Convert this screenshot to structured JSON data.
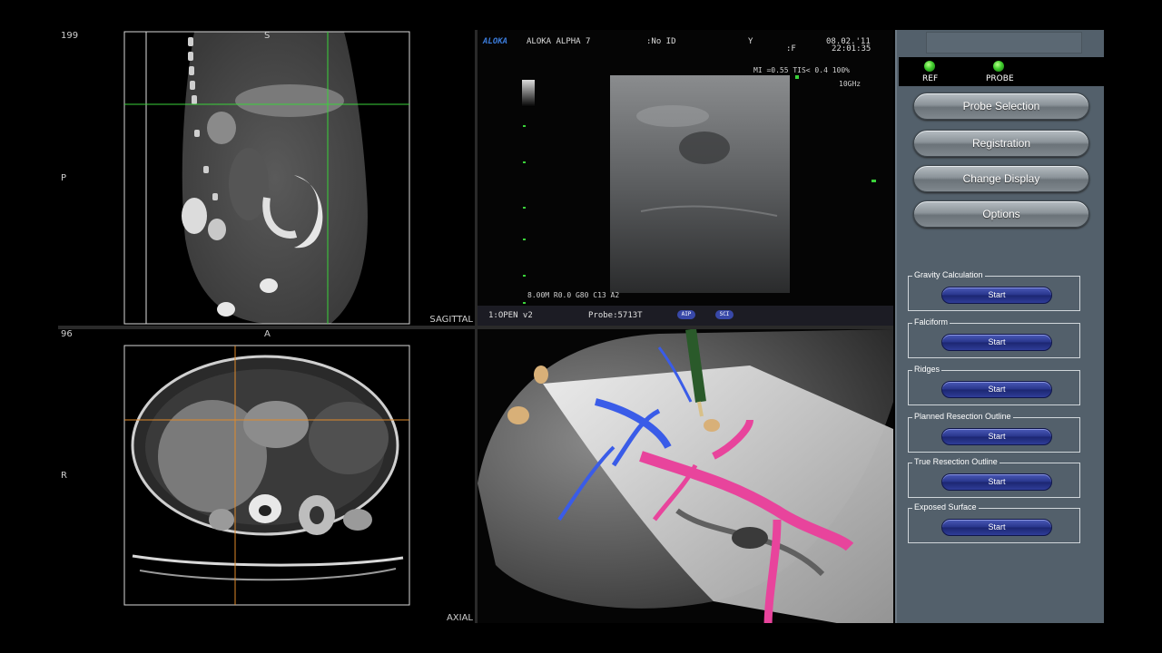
{
  "sagittal": {
    "slice": "199",
    "orient_top": "S",
    "orient_left": "P",
    "label": "SAGITTAL"
  },
  "axial": {
    "slice": "96",
    "orient_top": "A",
    "orient_left": "R",
    "label": "AXIAL"
  },
  "ultrasound": {
    "brand": "ALOKA",
    "model": "ALOKA ALPHA 7",
    "patient_id": ":No ID",
    "field_y": "Y",
    "field_f": ":F",
    "date": "08.02.'11",
    "time": "22:01:35",
    "mi_tis": "MI =0.55 TIS< 0.4 100%",
    "freq": "10GHz",
    "params": "8.00M R0.0 G80 C13 A2",
    "mode": "1:OPEN v2",
    "probe": "Probe:5713T",
    "badge_1": "AIP",
    "badge_2": "SCI"
  },
  "status": {
    "ref_label": "REF",
    "probe_label": "PROBE"
  },
  "buttons": [
    {
      "label": "Probe Selection"
    },
    {
      "label": "Registration"
    },
    {
      "label": "Change Display"
    },
    {
      "label": "Options"
    }
  ],
  "tools": [
    {
      "label": "Gravity Calculation",
      "button": "Start"
    },
    {
      "label": "Falciform",
      "button": "Start"
    },
    {
      "label": "Ridges",
      "button": "Start"
    },
    {
      "label": "Planned Resection Outline",
      "button": "Start"
    },
    {
      "label": "True Resection Outline",
      "button": "Start"
    },
    {
      "label": "Exposed Surface",
      "button": "Start"
    }
  ],
  "colors": {
    "panel": "#53606b",
    "start_button": "#27348a",
    "led": "#3dcc2b",
    "crosshair_sagittal": "#3ad23a",
    "crosshair_axial": "#e08a2a",
    "portal_vein": "#e8449c",
    "hepatic_vein": "#3a5ce8"
  }
}
